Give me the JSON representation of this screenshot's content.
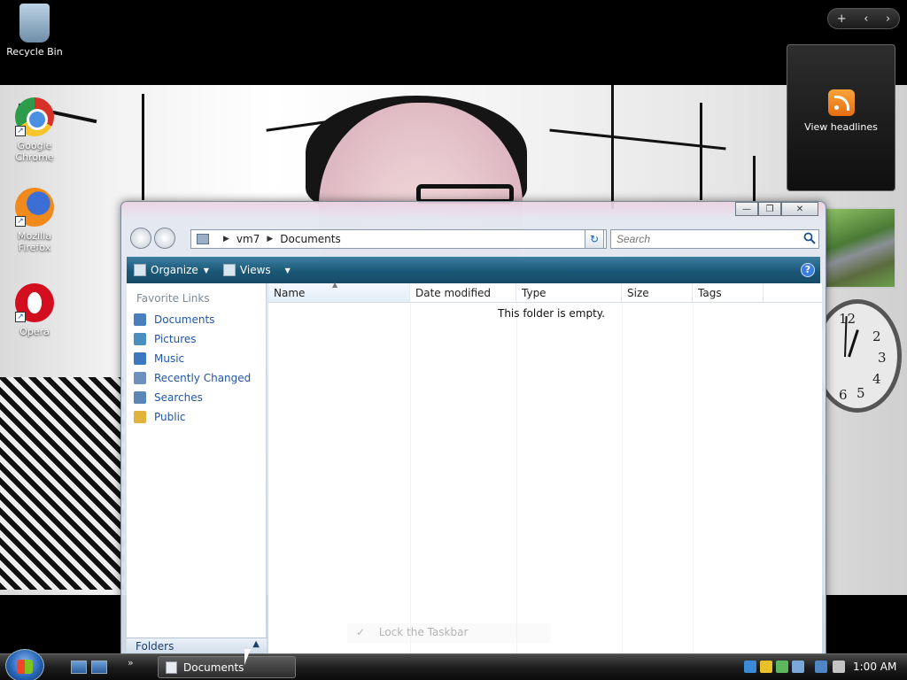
{
  "desktop": {
    "icons": [
      {
        "label": "Recycle Bin"
      },
      {
        "label": "Google Chrome"
      },
      {
        "label": "Mozilla Firefox"
      },
      {
        "label": "Opera"
      }
    ]
  },
  "gadgets": {
    "controls": {
      "add": "+",
      "prev": "‹",
      "next": "›"
    },
    "feed": {
      "label": "View headlines"
    },
    "clock": {
      "numbers": [
        "12",
        "2",
        "3",
        "4",
        "5",
        "6"
      ]
    }
  },
  "explorer": {
    "title_buttons": {
      "minimize": "—",
      "maximize": "❐",
      "close": "✕"
    },
    "breadcrumb": [
      "vm7",
      "Documents"
    ],
    "search": {
      "placeholder": "Search"
    },
    "toolbar": {
      "organize": "Organize",
      "views": "Views",
      "help": "?"
    },
    "nav_pane": {
      "title": "Favorite Links",
      "links": [
        {
          "label": "Documents",
          "color": "#4a7fbd"
        },
        {
          "label": "Pictures",
          "color": "#4a8fbd"
        },
        {
          "label": "Music",
          "color": "#3b78c0"
        },
        {
          "label": "Recently Changed",
          "color": "#6f8fbf"
        },
        {
          "label": "Searches",
          "color": "#5a86b8"
        },
        {
          "label": "Public",
          "color": "#e2b33c"
        }
      ],
      "folders_label": "Folders"
    },
    "columns": [
      "Name",
      "Date modified",
      "Type",
      "Size",
      "Tags"
    ],
    "empty_message": "This folder is empty."
  },
  "context_ghost": {
    "label": "Lock the Taskbar"
  },
  "taskbar": {
    "task_button": "Documents",
    "chevron": "»",
    "clock": "1:00 AM"
  },
  "colors": {
    "toolbar": "#1b5877",
    "link": "#1f56a8",
    "rss": "#f08a1c"
  }
}
